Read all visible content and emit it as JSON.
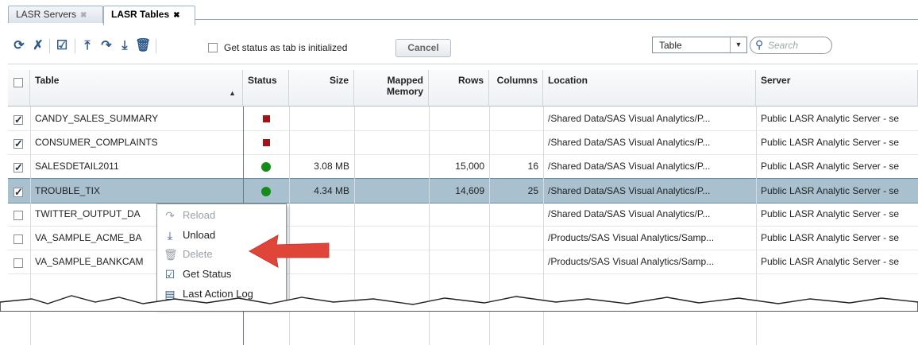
{
  "tabs": [
    {
      "label": "LASR Servers",
      "close": "✖"
    },
    {
      "label": "LASR Tables",
      "close": "✖"
    }
  ],
  "toolbar": {
    "icons": [
      "refresh-icon",
      "clear-icon",
      "select-icon",
      "load-icon",
      "reload-icon",
      "unload-icon",
      "delete-icon"
    ],
    "get_status_label": "Get status as tab is initialized",
    "cancel_label": "Cancel",
    "filter_combo_value": "Table",
    "search_placeholder": "Search"
  },
  "table": {
    "columns": [
      "Table",
      "Status",
      "Size",
      "Mapped Memory",
      "Rows",
      "Columns",
      "Location",
      "Server"
    ],
    "rows": [
      {
        "checked": true,
        "table": "CANDY_SALES_SUMMARY",
        "status": "unloaded",
        "size": "",
        "mapped": "",
        "rows": "",
        "columns": "",
        "location": "/Shared Data/SAS Visual Analytics/P...",
        "server": "Public LASR Analytic Server - se"
      },
      {
        "checked": true,
        "table": "CONSUMER_COMPLAINTS",
        "status": "unloaded",
        "size": "",
        "mapped": "",
        "rows": "",
        "columns": "",
        "location": "/Shared Data/SAS Visual Analytics/P...",
        "server": "Public LASR Analytic Server - se"
      },
      {
        "checked": true,
        "table": "SALESDETAIL2011",
        "status": "loaded",
        "size": "3.08 MB",
        "mapped": "",
        "rows": "15,000",
        "columns": "16",
        "location": "/Shared Data/SAS Visual Analytics/P...",
        "server": "Public LASR Analytic Server - se"
      },
      {
        "checked": true,
        "table": "TROUBLE_TIX",
        "status": "loaded",
        "size": "4.34 MB",
        "mapped": "",
        "rows": "14,609",
        "columns": "25",
        "location": "/Shared Data/SAS Visual Analytics/P...",
        "server": "Public LASR Analytic Server - se",
        "selected": true
      },
      {
        "checked": false,
        "table": "TWITTER_OUTPUT_DA",
        "status": "",
        "size": "",
        "mapped": "",
        "rows": "",
        "columns": "",
        "location": "/Shared Data/SAS Visual Analytics/P...",
        "server": "Public LASR Analytic Server - se"
      },
      {
        "checked": false,
        "table": "VA_SAMPLE_ACME_BA",
        "status": "",
        "size": "",
        "mapped": "",
        "rows": "",
        "columns": "",
        "location": "/Products/SAS Visual Analytics/Samp...",
        "server": "Public LASR Analytic Server - se"
      },
      {
        "checked": false,
        "table": "VA_SAMPLE_BANKCAM",
        "status": "",
        "size": "",
        "mapped": "",
        "rows": "",
        "columns": "",
        "location": "/Products/SAS Visual Analytics/Samp...",
        "server": "Public LASR Analytic Server - se"
      }
    ]
  },
  "context_menu": [
    {
      "label": "Reload",
      "icon": "reload-icon",
      "disabled": true
    },
    {
      "label": "Unload",
      "icon": "unload-icon",
      "disabled": false
    },
    {
      "label": "Delete",
      "icon": "delete-icon",
      "disabled": true
    },
    {
      "label": "Get Status",
      "icon": "get-status-icon",
      "disabled": false
    },
    {
      "label": "Last Action Log",
      "icon": "log-icon",
      "disabled": false
    }
  ],
  "colors": {
    "accent": "#2f5a8a",
    "selected_row": "#a9c0ce",
    "arrow": "#e0453a",
    "status_red": "#a3131a",
    "status_green": "#138c1a"
  }
}
